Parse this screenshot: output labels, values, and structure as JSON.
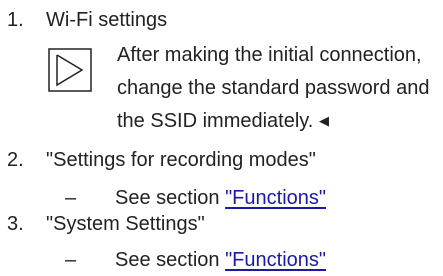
{
  "list": {
    "item1": {
      "number": "1.",
      "text": "Wi-Fi settings"
    },
    "note": {
      "icon": "note-play-icon",
      "line1": "After making the initial connection,",
      "line2": "change the standard password and",
      "line3": "the SSID immediately.",
      "end_mark": "◀"
    },
    "item2": {
      "number": "2.",
      "text": "\"Settings for recording modes\"",
      "sub": {
        "dash": "–",
        "prefix": "See section ",
        "link": "\"Functions\""
      }
    },
    "item3": {
      "number": "3.",
      "text": "\"System Settings\"",
      "sub": {
        "dash": "–",
        "prefix": "See section ",
        "link": "\"Functions\""
      }
    }
  },
  "colors": {
    "text": "#222222",
    "link": "#1a1aa6",
    "icon_stroke": "#222222"
  }
}
